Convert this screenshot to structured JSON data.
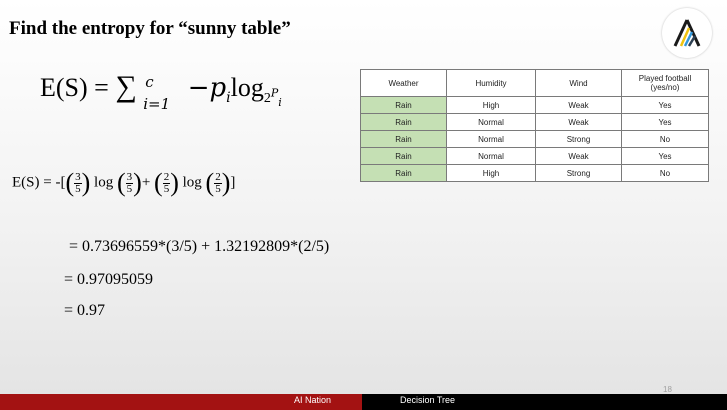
{
  "title": "Find the entropy for “sunny table”",
  "formula": {
    "lhs": "E(S) = ",
    "sum": "∑",
    "sup": "c",
    "sub": "i=1",
    "term_minus_p": "−p",
    "p_sub": "i",
    "log": "log",
    "log_sub": "2",
    "p_sub2": "P",
    "p_sub2_i": "i"
  },
  "expansion": {
    "lhs": "E(S) = -[",
    "f1_num": "3",
    "f1_den": "5",
    "log1": "log",
    "f2_num": "3",
    "f2_den": "5",
    "plus": "+",
    "f3_num": "2",
    "f3_den": "5",
    "log2": "log",
    "f4_num": "2",
    "f4_den": "5",
    "end": "]"
  },
  "steps": [
    "= 0.73696559*(3/5) + 1.32192809*(2/5)",
    "= 0.97095059",
    "= 0.97"
  ],
  "table": {
    "headers": [
      "Weather",
      "Humidity",
      "Wind",
      "Played football (yes/no)"
    ],
    "rows": [
      [
        "Rain",
        "High",
        "Weak",
        "Yes"
      ],
      [
        "Rain",
        "Normal",
        "Weak",
        "Yes"
      ],
      [
        "Rain",
        "Normal",
        "Strong",
        "No"
      ],
      [
        "Rain",
        "Normal",
        "Weak",
        "Yes"
      ],
      [
        "Rain",
        "High",
        "Strong",
        "No"
      ]
    ]
  },
  "page_number": "18",
  "footer": {
    "left": "AI Nation",
    "right": "Decision Tree"
  },
  "colors": {
    "weather_cell": "#c5e0b4",
    "footer_red": "#a31212",
    "footer_black": "#000000"
  },
  "logo": {
    "icon": "ai-nation-logo-icon"
  }
}
